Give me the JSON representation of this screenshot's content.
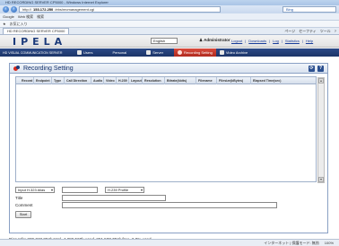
{
  "browser": {
    "title": "HD RECORDING SERVER CP5000 - Windows Internet Explorer",
    "url_prefix": "http://",
    "url_host": "153.172.250",
    "url_path": "/ebs/recmanagement.cgi",
    "search_engine": "Bing",
    "menu_items": [
      "Google",
      "Web 検索",
      "検索"
    ],
    "favorites_label": "お気に入り",
    "tab_title": "HD RECORDING SERVER CP5000",
    "tab_tools": [
      "ページ",
      "セーフティ",
      "ツール",
      "?"
    ],
    "status_zone": "インターネット | 保護モード: 無効",
    "zoom": "100%"
  },
  "header": {
    "logo": "IPELA",
    "language": "English",
    "admin_label": "Administrator",
    "links": [
      "Logout",
      "Downloads",
      "Log",
      "Statistics",
      "Help"
    ]
  },
  "nav": {
    "system_label": "HD VISUAL COMMUNICATION SERVER",
    "items": [
      {
        "label": "Users"
      },
      {
        "label": "Personal"
      },
      {
        "label": "Server"
      },
      {
        "label": "Recording Setting"
      },
      {
        "label": "Video Archive"
      }
    ]
  },
  "panel": {
    "title": "Recording Setting",
    "refresh_icon": "refresh-icon",
    "help_label": "?"
  },
  "table": {
    "columns": [
      "Record ID",
      "Endpoint",
      "Type",
      "Call Direction",
      "Audio",
      "Video",
      "H.239",
      "Layout",
      "Resolution",
      "Bitrate(kbits)",
      "Filename",
      "Filesize(kBytes)",
      "Elapsed Time(sec)"
    ]
  },
  "form": {
    "source_select": "Input H.323 Alias",
    "profile_select": "H.239 Profile",
    "title_label": "Title",
    "comment_label": "Comment",
    "start_label": "Start"
  },
  "disk": {
    "text": "Disc Info:  289,740,384k  total,   4,286,560k  used,   251,530,784k  free,   2.0%  used"
  }
}
